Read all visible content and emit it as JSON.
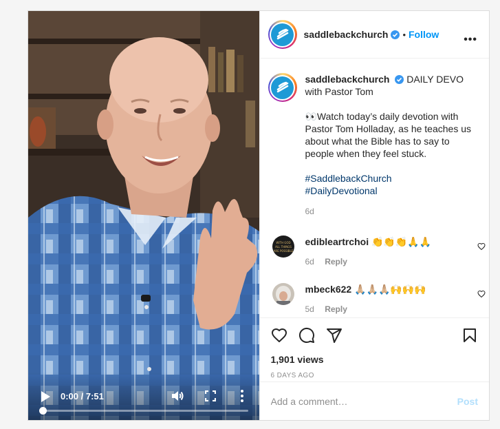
{
  "video": {
    "time": "0:00 / 7:51",
    "progress": 0.0,
    "icons": [
      "play-icon",
      "volume-icon",
      "fullscreen-icon",
      "more-vertical-icon"
    ]
  },
  "header": {
    "username": "saddlebackchurch",
    "separator": "•",
    "follow_label": "Follow",
    "more_label": "•••"
  },
  "caption": {
    "username": "saddlebackchurch",
    "title": " DAILY DEVO with Pastor Tom",
    "text": "👀Watch today’s daily devotion with Pastor Tom Holladay, as he teaches us about what the Bible has to say to people when they feel stuck.",
    "hashtags": [
      "#SaddlebackChurch",
      "#DailyDevotional"
    ],
    "age": "6d"
  },
  "comments": [
    {
      "username": "edibleartrchoi",
      "text": "👏👏👏🙏🙏",
      "age": "6d",
      "reply_label": "Reply",
      "avatar_text": "WITH GOD ALL THINGS ARE POSSIBLE"
    },
    {
      "username": "mbeck622",
      "text": "🙏🏼🙏🏼🙏🏼🙌🙌🙌",
      "age": "5d",
      "reply_label": "Reply"
    }
  ],
  "stats": {
    "views": "1,901 views",
    "date": "6 DAYS AGO"
  },
  "composer": {
    "placeholder": "Add a comment…",
    "post_label": "Post"
  },
  "colors": {
    "accent": "#0095f6",
    "hashtag": "#00376b",
    "brand": "#1e9ad6",
    "muted": "#8e8e8e"
  }
}
